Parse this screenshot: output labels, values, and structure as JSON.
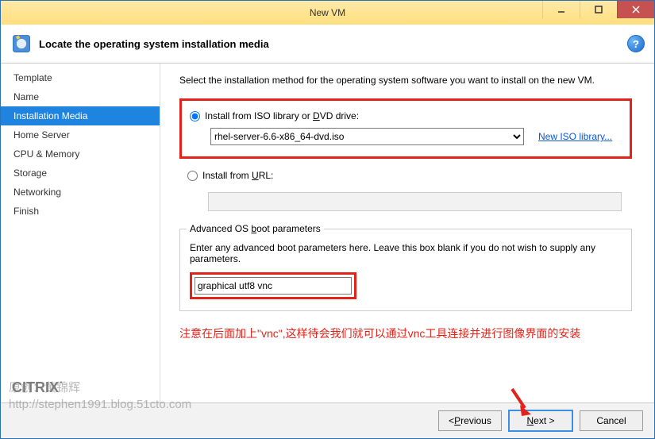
{
  "window": {
    "title": "New VM"
  },
  "header": {
    "title": "Locate the operating system installation media"
  },
  "sidebar": {
    "steps": [
      {
        "label": "Template"
      },
      {
        "label": "Name"
      },
      {
        "label": "Installation Media"
      },
      {
        "label": "Home Server"
      },
      {
        "label": "CPU & Memory"
      },
      {
        "label": "Storage"
      },
      {
        "label": "Networking"
      },
      {
        "label": "Finish"
      }
    ],
    "active_index": 2,
    "brand": "CITRIX"
  },
  "main": {
    "instruction": "Select the installation method for the operating system software you want to install on the new VM.",
    "radio_iso": {
      "prefix": "Install from ISO library or ",
      "u": "D",
      "suffix": "VD drive:"
    },
    "iso_selected": "rhel-server-6.6-x86_64-dvd.iso",
    "new_iso_link": "New ISO library...",
    "radio_url": {
      "prefix": "Install from ",
      "u": "U",
      "suffix": "RL:"
    },
    "url_value": "",
    "fieldset_legend": {
      "prefix": "Advanced OS ",
      "u": "b",
      "suffix": "oot parameters"
    },
    "field_desc": "Enter any advanced boot parameters here. Leave this box blank if you do not wish to supply any parameters.",
    "boot_params": "graphical utf8 vnc",
    "note": "注意在后面加上\"vnc\",这样待会我们就可以通过vnc工具连接并进行图像界面的安装"
  },
  "footer": {
    "previous": {
      "lt": "< ",
      "u": "P",
      "rest": "revious"
    },
    "next": {
      "u": "N",
      "rest": "ext >"
    },
    "cancel": "Cancel"
  },
  "watermark": {
    "line1": "原创：黄锦辉",
    "line2": "http://stephen1991.blog.51cto.com"
  }
}
